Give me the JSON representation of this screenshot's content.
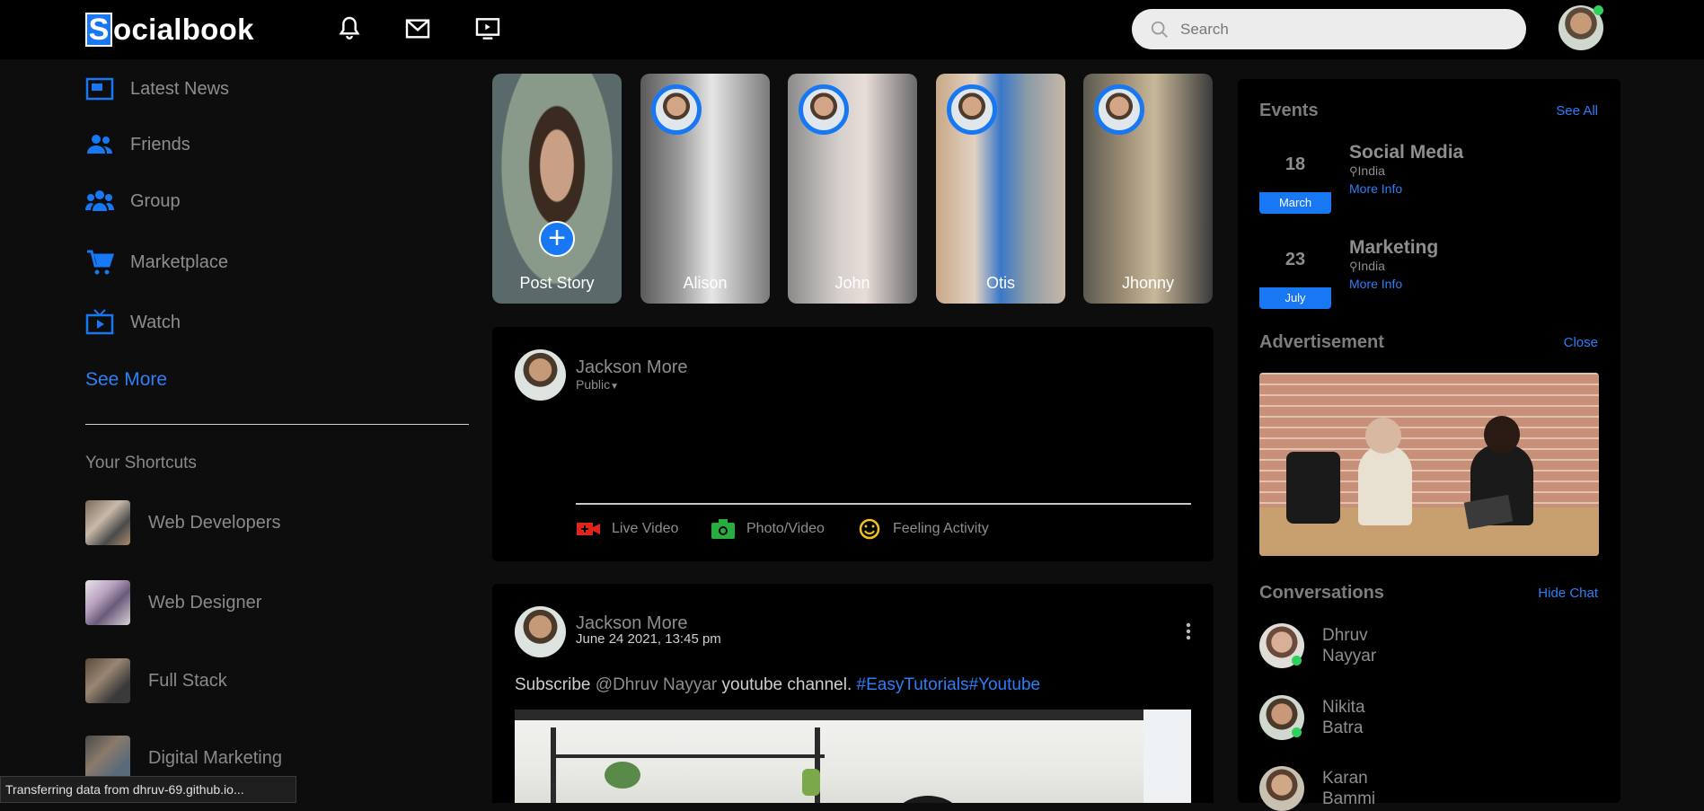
{
  "nav": {
    "logo_letter": "S",
    "logo_rest": "ocialbook",
    "search_placeholder": "Search",
    "icons": [
      "bell-icon",
      "mail-icon",
      "video-icon"
    ]
  },
  "sidebar": {
    "items": [
      {
        "label": "Latest News",
        "icon": "news-icon"
      },
      {
        "label": "Friends",
        "icon": "friends-icon"
      },
      {
        "label": "Group",
        "icon": "group-icon"
      },
      {
        "label": "Marketplace",
        "icon": "cart-icon"
      },
      {
        "label": "Watch",
        "icon": "tv-icon"
      }
    ],
    "see_more": "See More",
    "shortcuts_title": "Your Shortcuts",
    "shortcuts": [
      {
        "label": "Web Developers"
      },
      {
        "label": "Web Designer"
      },
      {
        "label": "Full Stack"
      },
      {
        "label": "Digital Marketing"
      }
    ]
  },
  "stories": [
    {
      "name": "Post Story"
    },
    {
      "name": "Alison"
    },
    {
      "name": "John"
    },
    {
      "name": "Otis"
    },
    {
      "name": "Jhonny"
    }
  ],
  "composer": {
    "user": "Jackson More",
    "privacy": "Public",
    "actions": [
      "Live Video",
      "Photo/Video",
      "Feeling Activity"
    ]
  },
  "post": {
    "user": "Jackson More",
    "time": "June 24 2021, 13:45 pm",
    "text_prefix": "Subscribe ",
    "mention": "@Dhruv Nayyar",
    "text_mid": " youtube channel. ",
    "tags": "#EasyTutorials#Youtube"
  },
  "right": {
    "events_title": "Events",
    "see_all": "See All",
    "events": [
      {
        "day": "18",
        "month": "March",
        "title": "Social Media",
        "location": "India",
        "more": "More Info"
      },
      {
        "day": "23",
        "month": "July",
        "title": "Marketing",
        "location": "India",
        "more": "More Info"
      }
    ],
    "ad_title": "Advertisement",
    "ad_close": "Close",
    "conv_title": "Conversations",
    "hide_chat": "Hide Chat",
    "conversations": [
      {
        "name": "Dhruv Nayyar"
      },
      {
        "name": "Nikita Batra"
      },
      {
        "name": "Karan Bammi"
      }
    ]
  },
  "status_bar": "Transferring data from dhruv-69.github.io...",
  "colors": {
    "accent": "#1877f2",
    "link": "#2d7ff9",
    "online": "#2fd15a"
  }
}
